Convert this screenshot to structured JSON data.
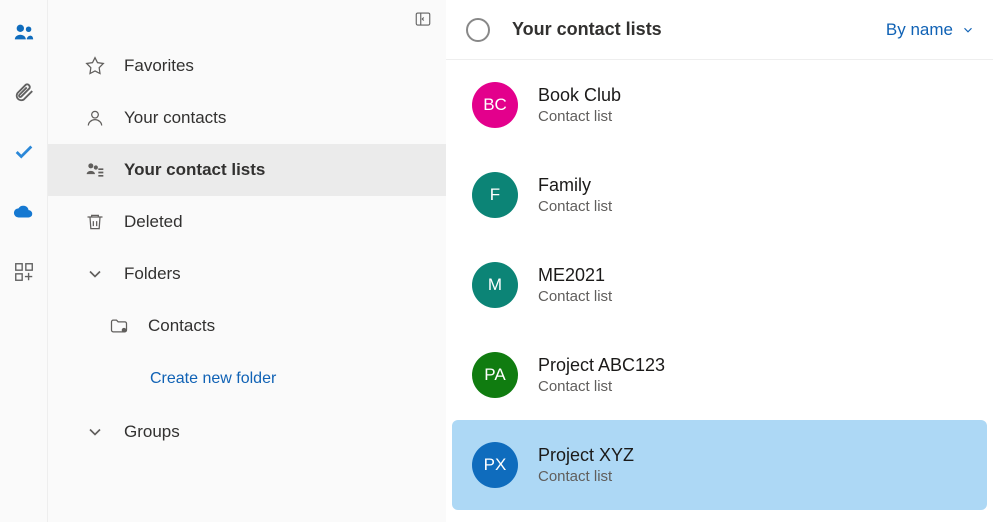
{
  "app_rail": [
    {
      "name": "people-icon",
      "color": "#0f6cbd"
    },
    {
      "name": "attach-icon",
      "color": "#616161"
    },
    {
      "name": "todo-icon",
      "color": "#2b88d8"
    },
    {
      "name": "cloud-icon",
      "color": "#1e90ff"
    },
    {
      "name": "apps-icon",
      "color": "#616161"
    }
  ],
  "sidebar": {
    "favorites": "Favorites",
    "your_contacts": "Your contacts",
    "your_contact_lists": "Your contact lists",
    "deleted": "Deleted",
    "folders": "Folders",
    "contacts_folder": "Contacts",
    "create_folder": "Create new folder",
    "groups": "Groups"
  },
  "main": {
    "title": "Your contact lists",
    "sort_label": "By name",
    "subtitle": "Contact list"
  },
  "lists": [
    {
      "initials": "BC",
      "name": "Book Club",
      "color": "#e3008c"
    },
    {
      "initials": "F",
      "name": "Family",
      "color": "#0c8476"
    },
    {
      "initials": "M",
      "name": "ME2021",
      "color": "#0c8476"
    },
    {
      "initials": "PA",
      "name": "Project ABC123",
      "color": "#107c10"
    },
    {
      "initials": "PX",
      "name": "Project XYZ",
      "color": "#0f6cbd"
    }
  ],
  "selected_index": 4
}
